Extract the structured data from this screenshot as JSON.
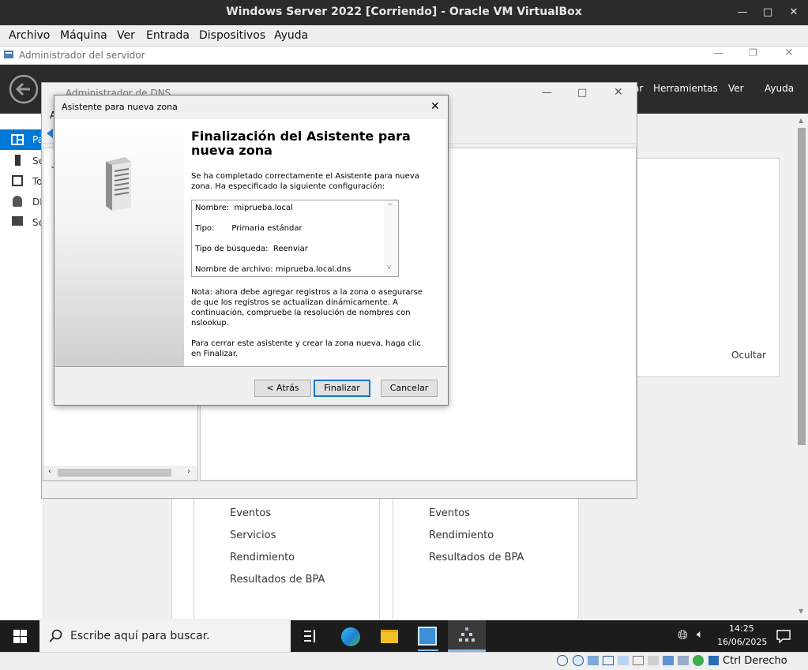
{
  "vbox": {
    "title": "Windows Server 2022 [Corriendo] - Oracle VM VirtualBox",
    "min": "—",
    "max": "□",
    "close": "✕",
    "menu": [
      "Archivo",
      "Máquina",
      "Ver",
      "Entrada",
      "Dispositivos",
      "Ayuda"
    ],
    "status_host_key": "Ctrl Derecho"
  },
  "server_manager": {
    "title": "Administrador del servidor",
    "header_menu": [
      "ar",
      "Herramientas",
      "Ver",
      "Ayuda"
    ],
    "nav_stubs": [
      "Pa",
      "Se",
      "To",
      "DI",
      "Se"
    ],
    "hide_label": "Ocultar",
    "tile1_items": [
      "Eventos",
      "Servicios",
      "Rendimiento",
      "Resultados de BPA"
    ],
    "tile2_items": [
      "Eventos",
      "Rendimiento",
      "Resultados de BPA"
    ]
  },
  "dns": {
    "title": "Administrador de DNS",
    "stub": "A"
  },
  "wizard": {
    "title": "Asistente para nueva zona",
    "close": "✕",
    "heading": "Finalización del Asistente para nueva zona",
    "intro": "Se ha completado correctamente el Asistente para nueva zona. Ha especificado la siguiente configuración:",
    "summary": [
      {
        "label": "Nombre:",
        "value": "miprueba.local"
      },
      {
        "label": "Tipo:",
        "value": "Primaria estándar"
      },
      {
        "label": "Tipo de búsqueda:",
        "value": "Reenviar"
      },
      {
        "label": "Nombre de archivo:",
        "value": "miprueba.local.dns"
      }
    ],
    "note": "Nota: ahora debe agregar registros a la zona o asegurarse de que los registros se actualizan dinámicamente. A continuación, compruebe la resolución de nombres con nslookup.",
    "closing": "Para cerrar este asistente y crear la zona nueva, haga clic en Finalizar.",
    "buttons": {
      "back": "< Atrás",
      "finish": "Finalizar",
      "cancel": "Cancelar"
    }
  },
  "taskbar": {
    "search_placeholder": "Escribe aquí para buscar.",
    "time": "14:25",
    "date": "16/06/2025"
  },
  "colors": {
    "accent": "#0078d7",
    "dark": "#2b2b2b"
  }
}
